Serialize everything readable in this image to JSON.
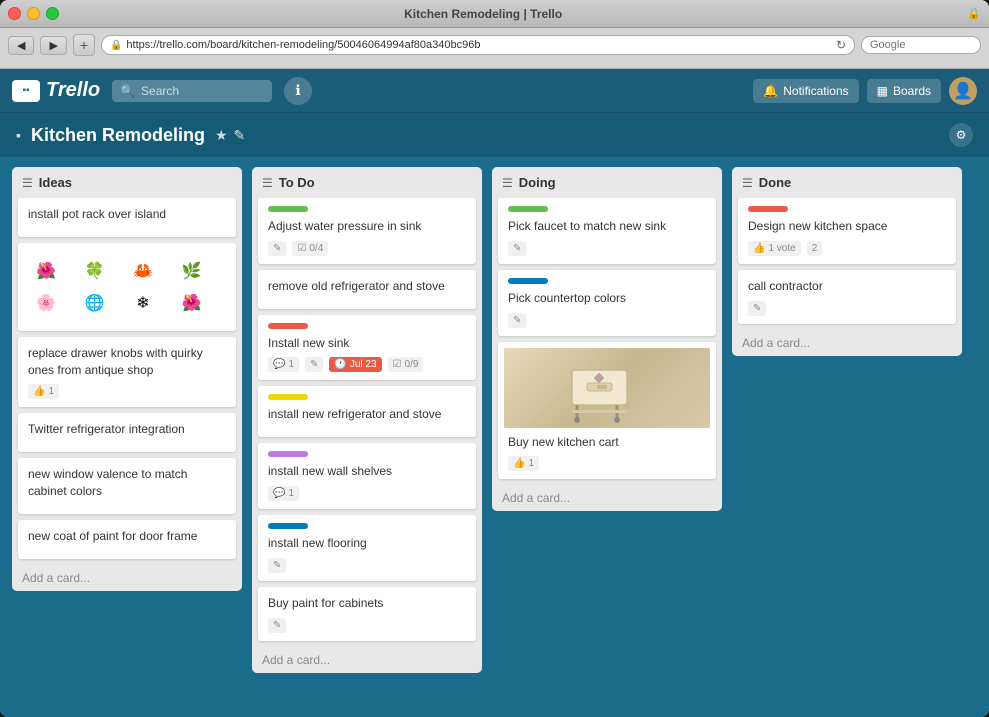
{
  "window": {
    "title": "Kitchen Remodeling | Trello",
    "url": "https://trello.com/board/kitchen-remodeling/50046064994af80a340bc96b"
  },
  "header": {
    "search_placeholder": "Search",
    "notifications_label": "Notifications",
    "boards_label": "Boards"
  },
  "board": {
    "title": "Kitchen Remodeling",
    "lists": [
      {
        "id": "ideas",
        "title": "Ideas",
        "cards": [
          {
            "id": "c1",
            "title": "install pot rack over island",
            "label_color": null,
            "badges": [],
            "has_image": false,
            "image_type": null
          },
          {
            "id": "c2",
            "title": "",
            "label_color": null,
            "badges": [],
            "has_image": true,
            "image_type": "knobs"
          },
          {
            "id": "c3",
            "title": "replace drawer knobs with quirky ones from antique shop",
            "label_color": null,
            "badges": [
              {
                "type": "vote",
                "count": "1"
              }
            ],
            "has_image": false,
            "image_type": null
          },
          {
            "id": "c4",
            "title": "Twitter refrigerator integration",
            "label_color": null,
            "badges": [],
            "has_image": false,
            "image_type": null
          },
          {
            "id": "c5",
            "title": "new window valence to match cabinet colors",
            "label_color": null,
            "badges": [],
            "has_image": false,
            "image_type": null
          },
          {
            "id": "c6",
            "title": "new coat of paint for door frame",
            "label_color": null,
            "badges": [],
            "has_image": false,
            "image_type": null
          }
        ],
        "add_card_label": "Add a card..."
      },
      {
        "id": "todo",
        "title": "To Do",
        "cards": [
          {
            "id": "t1",
            "title": "Adjust water pressure in sink",
            "label_color": "green",
            "badges": [
              {
                "type": "edit"
              },
              {
                "type": "checklist",
                "value": "0/4"
              }
            ],
            "has_image": false,
            "image_type": null
          },
          {
            "id": "t2",
            "title": "remove old refrigerator and stove",
            "label_color": null,
            "badges": [],
            "has_image": false,
            "image_type": null
          },
          {
            "id": "t3",
            "title": "Install new sink",
            "label_color": "red",
            "badges": [
              {
                "type": "comment",
                "count": "1"
              },
              {
                "type": "edit"
              },
              {
                "type": "due",
                "value": "Jul 23",
                "overdue": true
              },
              {
                "type": "checklist",
                "value": "0/9"
              }
            ],
            "has_image": false,
            "image_type": null
          },
          {
            "id": "t4",
            "title": "install new refrigerator and stove",
            "label_color": "yellow",
            "badges": [],
            "has_image": false,
            "image_type": null
          },
          {
            "id": "t5",
            "title": "install new wall shelves",
            "label_color": "purple",
            "badges": [
              {
                "type": "comment",
                "count": "1"
              }
            ],
            "has_image": false,
            "image_type": null
          },
          {
            "id": "t6",
            "title": "install new flooring",
            "label_color": "blue",
            "badges": [],
            "has_image": false,
            "image_type": null
          },
          {
            "id": "t7",
            "title": "Buy paint for cabinets",
            "label_color": null,
            "badges": [],
            "has_image": false,
            "image_type": null
          }
        ],
        "add_card_label": "Add a card..."
      },
      {
        "id": "doing",
        "title": "Doing",
        "cards": [
          {
            "id": "d1",
            "title": "Pick faucet to match new sink",
            "label_color": "green",
            "badges": [],
            "has_image": false,
            "image_type": null
          },
          {
            "id": "d2",
            "title": "Pick countertop colors",
            "label_color": "blue",
            "badges": [],
            "has_image": false,
            "image_type": null
          },
          {
            "id": "d3",
            "title": "Buy new kitchen cart",
            "label_color": null,
            "badges": [
              {
                "type": "vote",
                "count": "1"
              }
            ],
            "has_image": true,
            "image_type": "cart"
          }
        ],
        "add_card_label": "Add a card..."
      },
      {
        "id": "done",
        "title": "Done",
        "cards": [
          {
            "id": "dn1",
            "title": "Design new kitchen space",
            "label_color": "red",
            "badges": [
              {
                "type": "vote",
                "count": "1 vote"
              },
              {
                "type": "count",
                "value": "2"
              }
            ],
            "has_image": false,
            "image_type": null
          },
          {
            "id": "dn2",
            "title": "call contractor",
            "label_color": null,
            "badges": [],
            "has_image": false,
            "image_type": null
          }
        ],
        "add_card_label": "Add a card..."
      }
    ]
  },
  "labels": {
    "edit_icon": "✎",
    "comment_icon": "💬",
    "checklist_icon": "☑",
    "due_icon": "🕐",
    "vote_icon": "👍",
    "gear_icon": "⚙",
    "bell_icon": "🔔",
    "boards_icon": "▦",
    "search_icon": "🔍",
    "info_icon": "ℹ",
    "back_icon": "◀",
    "forward_icon": "▶"
  }
}
